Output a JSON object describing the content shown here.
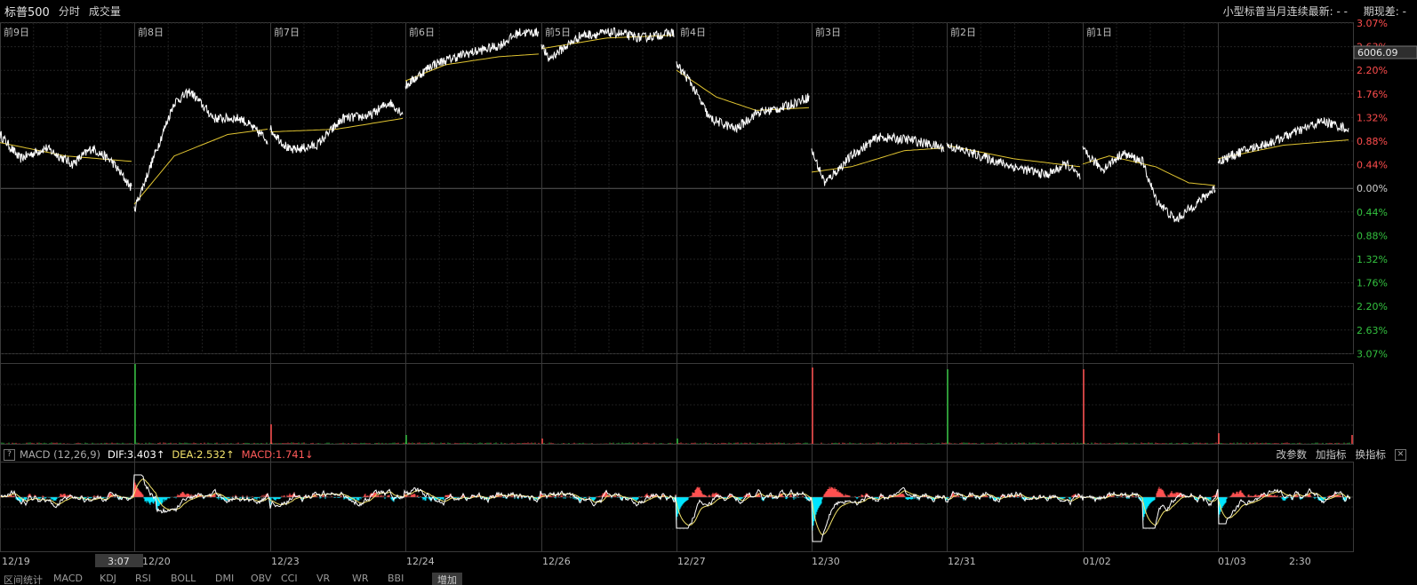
{
  "header": {
    "instrument": "标普500",
    "mode_intraday": "分时",
    "mode_volume": "成交量",
    "latest_label": "小型标普当月连续最新: - -",
    "basis_label": "期现差: -"
  },
  "day_labels": [
    "前9日",
    "前8日",
    "前7日",
    "前6日",
    "前5日",
    "前4日",
    "前3日",
    "前2日",
    "前1日"
  ],
  "y_labels": [
    "3.07%",
    "2.63%",
    "2.20%",
    "1.76%",
    "1.32%",
    "0.88%",
    "0.44%",
    "0.00%",
    "0.44%",
    "0.88%",
    "1.32%",
    "1.76%",
    "2.20%",
    "2.63%",
    "3.07%"
  ],
  "price_tag": "6006.09",
  "cursor_time": "3:07",
  "x_dates": [
    "12/19",
    "12/20",
    "12/23",
    "12/24",
    "12/26",
    "12/27",
    "12/30",
    "12/31",
    "01/02",
    "01/03",
    "2:30"
  ],
  "macd": {
    "help": "?",
    "name": "MACD (12,26,9)",
    "dif": "DIF:3.403↑",
    "dea": "DEA:2.532↑",
    "macd": "MACD:1.741↓",
    "btn_params": "改参数",
    "btn_add": "加指标",
    "btn_swap": "换指标",
    "btn_close": "✕"
  },
  "bottom_tabs": [
    "区间统计",
    "MACD",
    "KDJ",
    "RSI",
    "BOLL",
    "DMI",
    "OBV",
    "CCI",
    "VR",
    "WR",
    "BBI",
    "增加"
  ],
  "colors": {
    "up": "#ff4d4d",
    "down": "#33c13f",
    "price_line": "#ffffff",
    "avg_line": "#e0c431",
    "dif_line": "#ffffff",
    "dea_line": "#f2e26b",
    "macd_pos": "#ff5050",
    "macd_neg": "#00e5ff",
    "grid": "#2a2a2a"
  }
}
